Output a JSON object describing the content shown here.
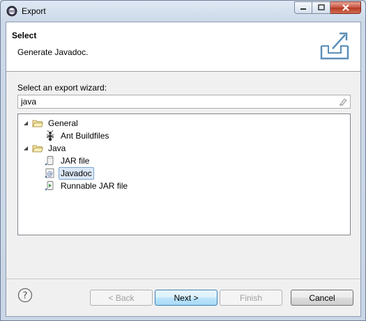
{
  "window": {
    "title": "Export"
  },
  "header": {
    "title": "Select",
    "description": "Generate Javadoc."
  },
  "wizard": {
    "label": "Select an export wizard:",
    "filter_value": "java"
  },
  "tree": {
    "general": {
      "label": "General",
      "children": [
        {
          "label": "Ant Buildfiles",
          "icon": "ant-icon"
        }
      ]
    },
    "java": {
      "label": "Java",
      "children": [
        {
          "label": "JAR file",
          "icon": "jar-file-icon"
        },
        {
          "label": "Javadoc",
          "icon": "javadoc-icon",
          "selected": true
        },
        {
          "label": "Runnable JAR file",
          "icon": "runnable-jar-icon"
        }
      ]
    }
  },
  "buttons": {
    "back": "< Back",
    "next": "Next >",
    "finish": "Finish",
    "cancel": "Cancel"
  },
  "colors": {
    "selection": "#dbe8f7",
    "selection_border": "#7da2ce",
    "close": "#c7533f"
  }
}
